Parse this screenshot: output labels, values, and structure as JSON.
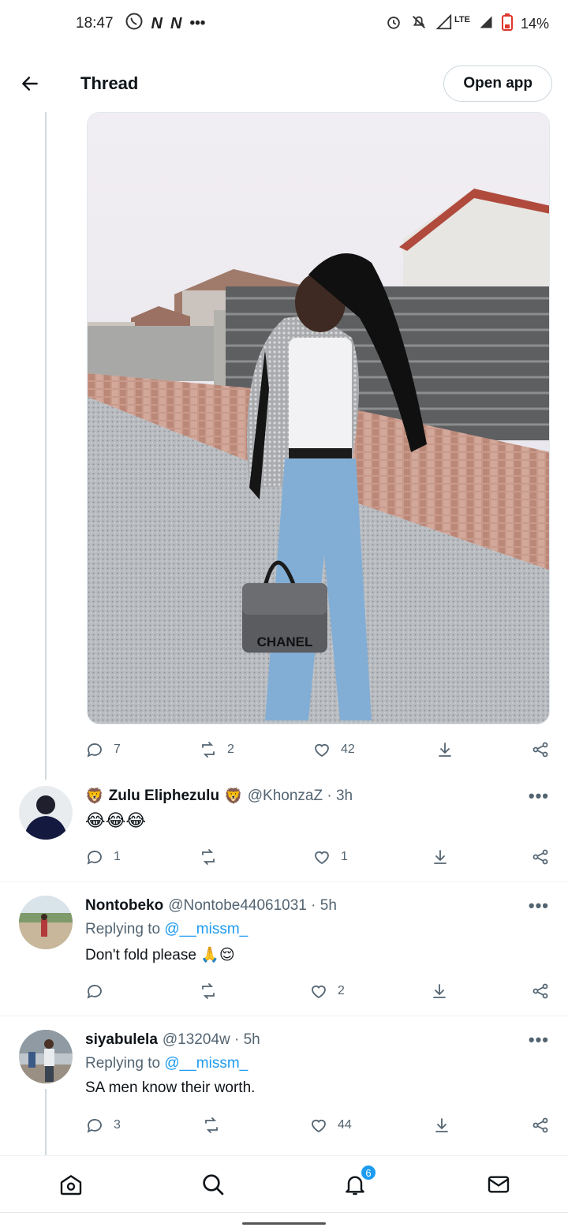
{
  "status_bar": {
    "time": "18:47",
    "left_icons": [
      "whatsapp-icon",
      "netflix-icon",
      "netflix-icon",
      "more-dots-icon"
    ],
    "n1": "N",
    "n2": "N",
    "dots": "•••",
    "lte": "LTE",
    "battery": "14%"
  },
  "header": {
    "title": "Thread",
    "open_app": "Open app"
  },
  "main_tweet": {
    "image_text": "CHANEL",
    "actions": {
      "replies": "7",
      "retweets": "2",
      "likes": "42"
    }
  },
  "replies": [
    {
      "name_prefix_emoji": "🦁",
      "name": "Zulu Eliphezulu",
      "name_suffix_emoji": "🦁",
      "handle": "@KhonzaZ · 3h",
      "text": "😂😂😂",
      "actions": {
        "replies": "1",
        "retweets": "",
        "likes": "1"
      }
    },
    {
      "name": "Nontobeko",
      "handle": "@Nontobe44061031 · 5h",
      "replying_label": "Replying to",
      "replying_to": "@__missm_",
      "text": "Don't fold please 🙏😌",
      "actions": {
        "replies": "",
        "retweets": "",
        "likes": "2"
      }
    },
    {
      "name": "siyabulela",
      "handle": "@13204w · 5h",
      "replying_label": "Replying to",
      "replying_to": "@__missm_",
      "text": "SA men know their worth.",
      "actions": {
        "replies": "3",
        "retweets": "",
        "likes": "44"
      }
    }
  ],
  "more_label": "•••",
  "bottom_nav": {
    "notifications_badge": "6"
  },
  "colors": {
    "accent": "#1d9bf0",
    "secondary_text": "#536471",
    "divider": "#eff3f4"
  }
}
